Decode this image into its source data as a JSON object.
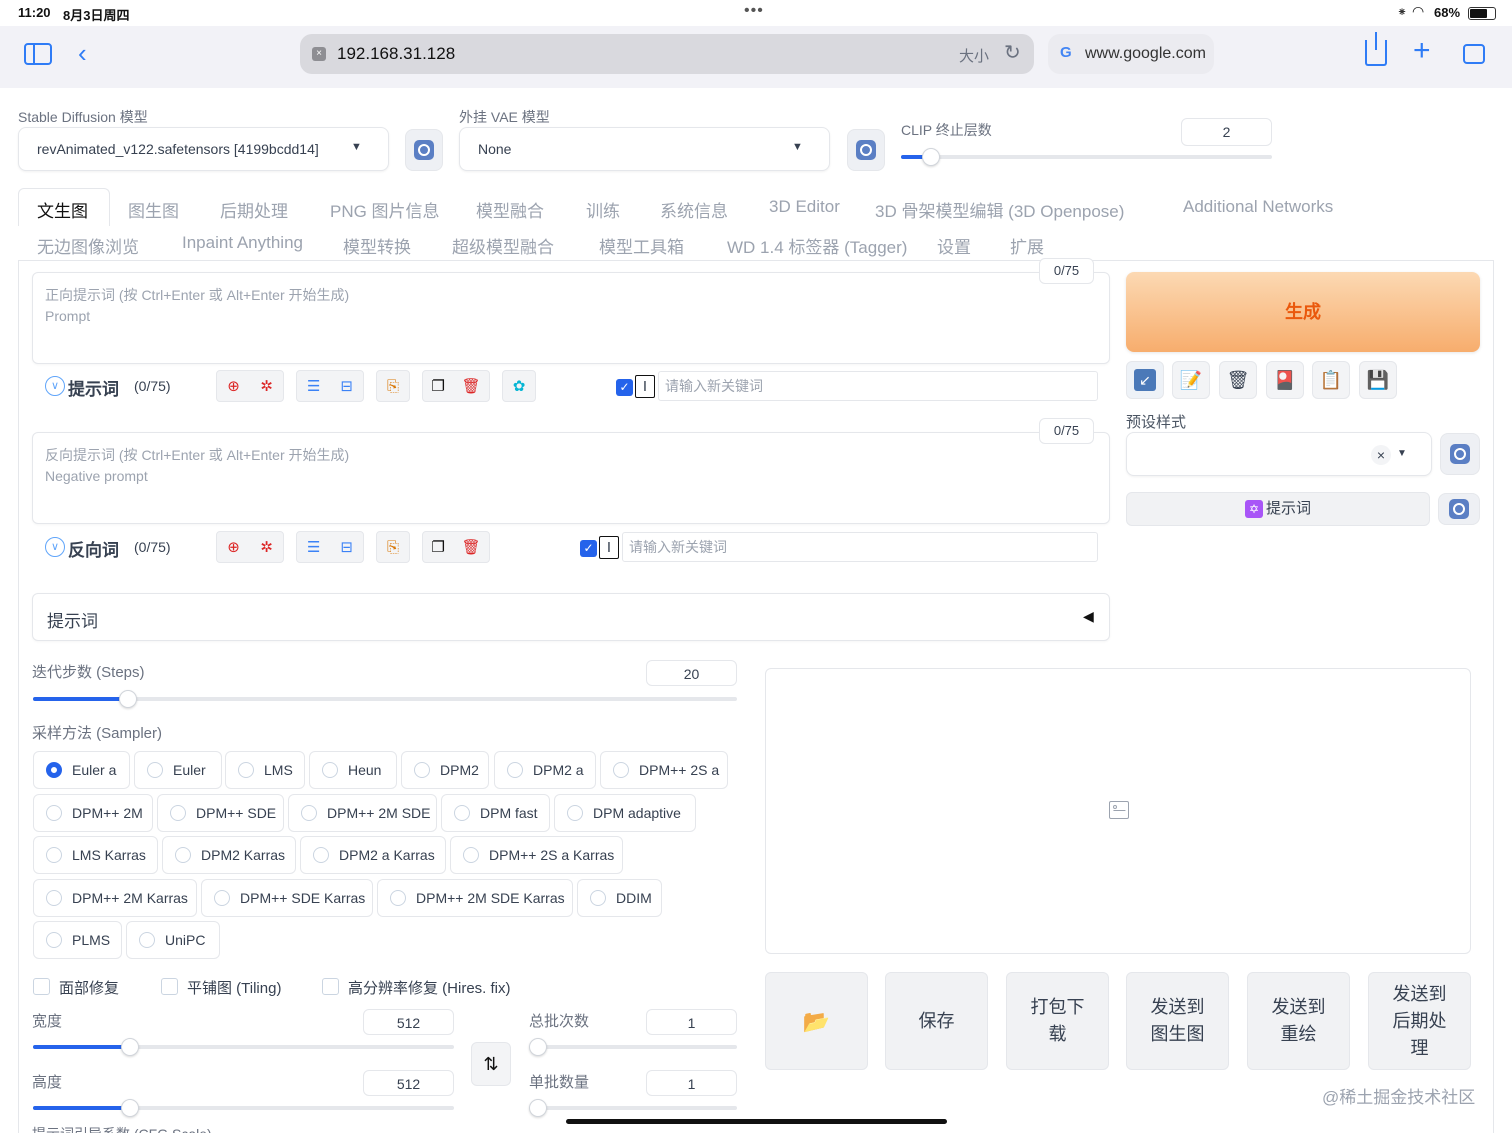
{
  "status": {
    "time": "11:20",
    "date": "8月3日周四",
    "battery": "68%"
  },
  "browser": {
    "url": "192.168.31.128",
    "text_size": "大小",
    "tab2": "www.google.com"
  },
  "model": {
    "sd_label": "Stable Diffusion 模型",
    "sd_value": "revAnimated_v122.safetensors [4199bcdd14]",
    "vae_label": "外挂 VAE 模型",
    "vae_value": "None",
    "clip_label": "CLIP 终止层数",
    "clip_value": "2",
    "clip_fraction": 0.08
  },
  "tabs_row1": [
    "文生图",
    "图生图",
    "后期处理",
    "PNG 图片信息",
    "模型融合",
    "训练",
    "系统信息",
    "3D Editor",
    "3D 骨架模型编辑 (3D Openpose)",
    "Additional Networks"
  ],
  "tabs_row2": [
    "无边图像浏览",
    "Inpaint Anything",
    "模型转换",
    "超级模型融合",
    "模型工具箱",
    "WD 1.4 标签器 (Tagger)",
    "设置",
    "扩展"
  ],
  "prompt": {
    "placeholder1": "正向提示词 (按 Ctrl+Enter 或 Alt+Enter 开始生成)",
    "placeholder2": "Prompt",
    "counter": "0/75",
    "tool_label": "提示词",
    "tool_count": "(0/75)",
    "kw_placeholder": "请输入新关键词"
  },
  "neg": {
    "placeholder1": "反向提示词 (按 Ctrl+Enter 或 Alt+Enter 开始生成)",
    "placeholder2": "Negative prompt",
    "counter": "0/75",
    "tool_label": "反向词",
    "tool_count": "(0/75)",
    "kw_placeholder": "请输入新关键词"
  },
  "generate": {
    "label": "生成",
    "preset_label": "预设样式",
    "prompt_btn": "提示词"
  },
  "accordion": {
    "label": "提示词"
  },
  "steps": {
    "label": "迭代步数 (Steps)",
    "value": "20",
    "fraction": 0.135
  },
  "sampler": {
    "label": "采样方法 (Sampler)",
    "selected": "Euler a",
    "options": [
      [
        "Euler a",
        "Euler",
        "LMS",
        "Heun",
        "DPM2",
        "DPM2 a",
        "DPM++ 2S a"
      ],
      [
        "DPM++ 2M",
        "DPM++ SDE",
        "DPM++ 2M SDE",
        "DPM fast",
        "DPM adaptive"
      ],
      [
        "LMS Karras",
        "DPM2 Karras",
        "DPM2 a Karras",
        "DPM++ 2S a Karras"
      ],
      [
        "DPM++ 2M Karras",
        "DPM++ SDE Karras",
        "DPM++ 2M SDE Karras",
        "DDIM"
      ],
      [
        "PLMS",
        "UniPC"
      ]
    ]
  },
  "checks": {
    "face": "面部修复",
    "tiling": "平铺图 (Tiling)",
    "hires": "高分辨率修复 (Hires. fix)"
  },
  "size": {
    "width_label": "宽度",
    "width": "512",
    "width_fraction": 0.23,
    "height_label": "高度",
    "height": "512",
    "height_fraction": 0.23
  },
  "batch": {
    "count_label": "总批次数",
    "count": "1",
    "size_label": "单批数量",
    "size": "1"
  },
  "cfg_label": "提示词引导系数 (CFG Scale)",
  "actions": [
    "保存",
    "打包下载",
    "发送到图生图",
    "发送到重绘",
    "发送到后期处理"
  ],
  "watermark": "@稀土掘金技术社区"
}
